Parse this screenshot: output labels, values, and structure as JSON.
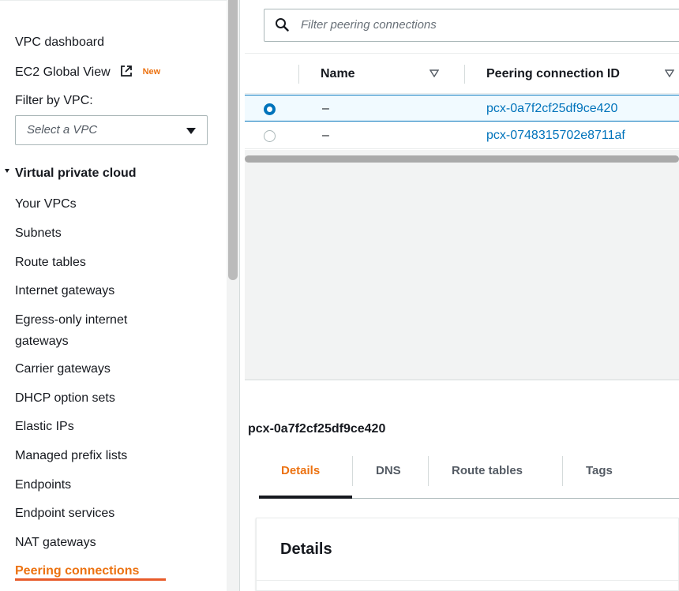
{
  "sidebar": {
    "dashboard": "VPC dashboard",
    "global_view": "EC2 Global View",
    "global_view_badge": "New",
    "filter_label": "Filter by VPC:",
    "vpc_select_placeholder": "Select a VPC",
    "section_title": "Virtual private cloud",
    "items": [
      "Your VPCs",
      "Subnets",
      "Route tables",
      "Internet gateways",
      "Egress-only internet",
      "gateways",
      "Carrier gateways",
      "DHCP option sets",
      "Elastic IPs",
      "Managed prefix lists",
      "Endpoints",
      "Endpoint services",
      "NAT gateways",
      "Peering connections"
    ]
  },
  "search": {
    "placeholder": "Filter peering connections"
  },
  "table": {
    "columns": [
      "Name",
      "Peering connection ID"
    ],
    "rows": [
      {
        "name": "–",
        "id": "pcx-0a7f2cf25df9ce420",
        "selected": true
      },
      {
        "name": "–",
        "id": "pcx-0748315702e8711af",
        "selected": false
      }
    ]
  },
  "detail": {
    "title": "pcx-0a7f2cf25df9ce420",
    "tabs": [
      "Details",
      "DNS",
      "Route tables",
      "Tags"
    ],
    "active_tab": "Details",
    "panel_title": "Details"
  },
  "colors": {
    "accent": "#ec7211",
    "link": "#0073bb",
    "underline": "#e85b2a"
  }
}
